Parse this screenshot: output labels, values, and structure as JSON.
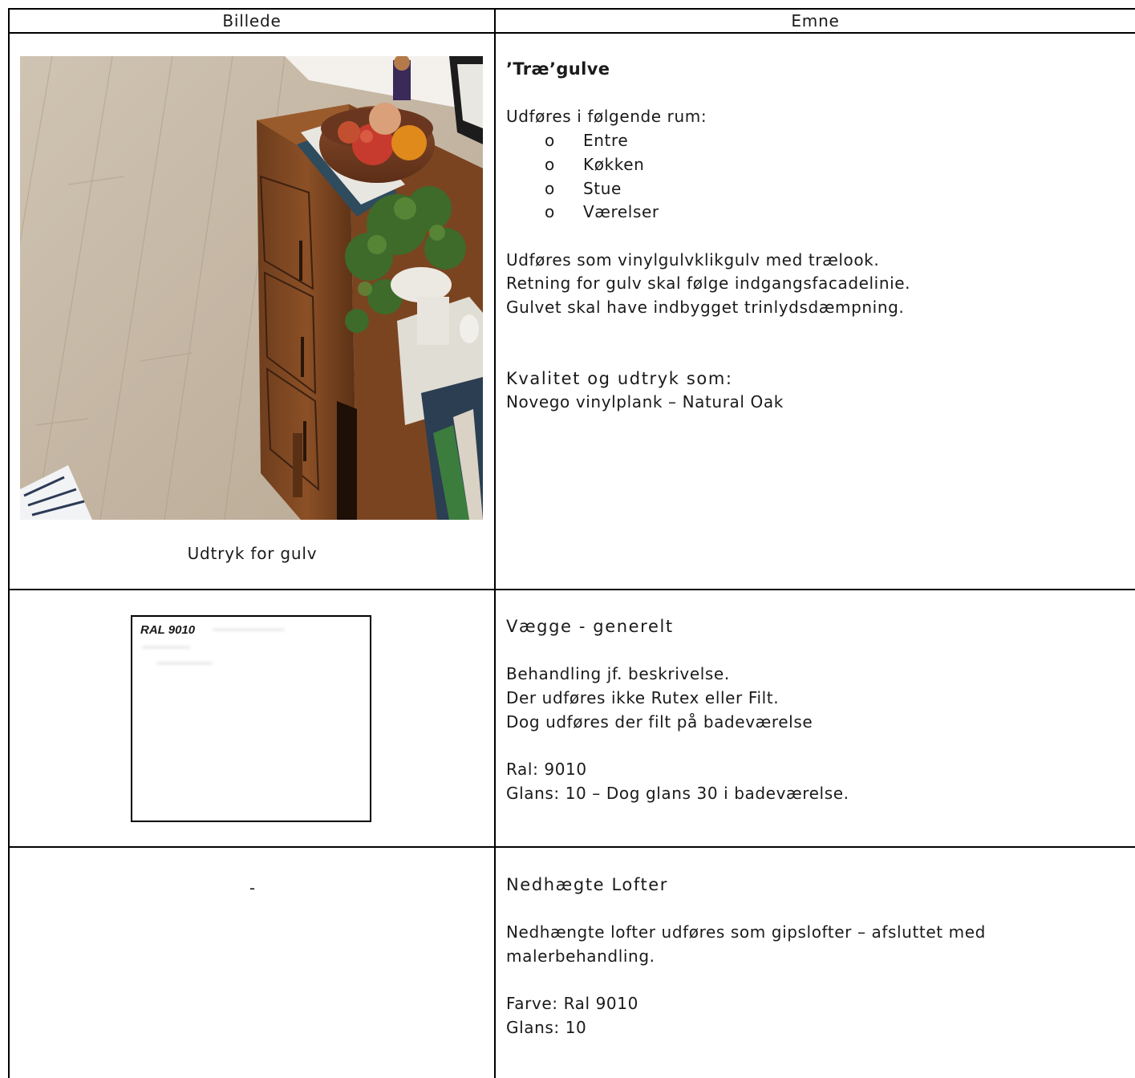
{
  "table": {
    "headers": {
      "image": "Billede",
      "subject": "Emne"
    }
  },
  "rows": [
    {
      "caption": "Udtryk for gulv",
      "title": "’Træ’gulve",
      "rooms_intro": "Udføres i følgende rum:",
      "bullet_marker": "o",
      "rooms": [
        "Entre",
        "Køkken",
        "Stue",
        "Værelser"
      ],
      "lines": [
        "Udføres som vinylgulvklikgulv med trælook.",
        "Retning for gulv skal følge indgangsfacadelinie.",
        "Gulvet skal have indbygget trinlydsdæmpning."
      ],
      "quality_title": "Kvalitet og udtryk som:",
      "quality_value": "Novego vinylplank – Natural Oak"
    },
    {
      "swatch_label": "RAL 9010",
      "swatch_color": "#FFFFFF",
      "title": "Vægge - generelt",
      "lines": [
        "Behandling jf. beskrivelse.",
        "Der udføres ikke Rutex eller Filt.",
        "Dog udføres der filt på badeværelse"
      ],
      "ral": "Ral: 9010",
      "glans": "Glans: 10 – Dog glans 30 i badeværelse."
    },
    {
      "image_placeholder": "-",
      "title": "Nedhægte Lofter",
      "desc": "Nedhængte lofter udføres som gipslofter – afsluttet med malerbehandling.",
      "farve": "Farve: Ral 9010",
      "glans": "Glans: 10"
    }
  ]
}
